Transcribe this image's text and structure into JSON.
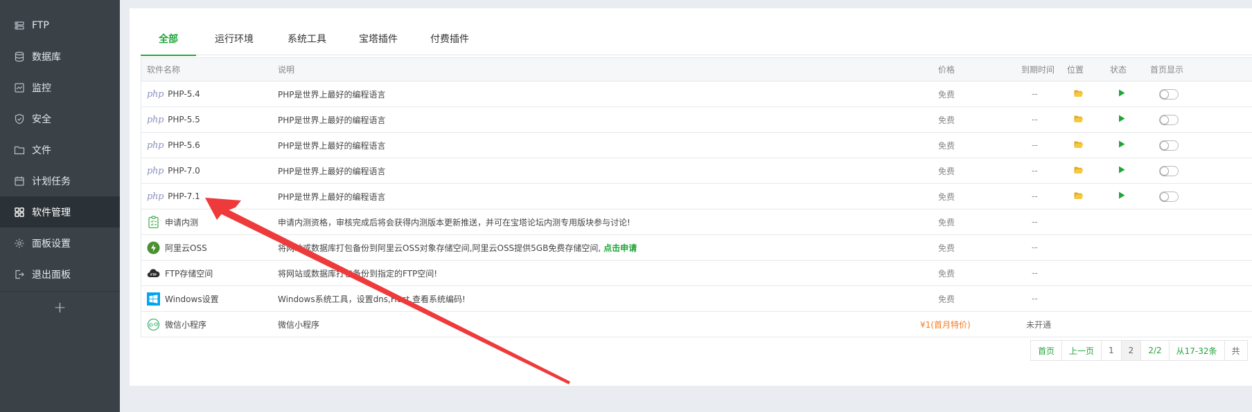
{
  "sidebar": {
    "items": [
      {
        "label": "FTP",
        "icon": "ftp-icon"
      },
      {
        "label": "数据库",
        "icon": "database-icon"
      },
      {
        "label": "监控",
        "icon": "monitor-icon"
      },
      {
        "label": "安全",
        "icon": "shield-icon"
      },
      {
        "label": "文件",
        "icon": "folder-icon"
      },
      {
        "label": "计划任务",
        "icon": "calendar-icon"
      },
      {
        "label": "软件管理",
        "icon": "grid-icon",
        "active": true
      },
      {
        "label": "面板设置",
        "icon": "gear-icon"
      },
      {
        "label": "退出面板",
        "icon": "logout-icon"
      }
    ],
    "add_label": "+"
  },
  "tabs": [
    {
      "label": "全部",
      "active": true
    },
    {
      "label": "运行环境"
    },
    {
      "label": "系统工具"
    },
    {
      "label": "宝塔插件"
    },
    {
      "label": "付费插件"
    }
  ],
  "table": {
    "headers": {
      "name": "软件名称",
      "desc": "说明",
      "price": "价格",
      "expire": "到期时间",
      "location": "位置",
      "status": "状态",
      "home": "首页显示"
    },
    "rows": [
      {
        "logo": "php",
        "logo_text": "php",
        "name": "PHP-5.4",
        "desc": "PHP是世界上最好的编程语言",
        "price": "免费",
        "expire": "--",
        "has_controls": true
      },
      {
        "logo": "php",
        "logo_text": "php",
        "name": "PHP-5.5",
        "desc": "PHP是世界上最好的编程语言",
        "price": "免费",
        "expire": "--",
        "has_controls": true
      },
      {
        "logo": "php",
        "logo_text": "php",
        "name": "PHP-5.6",
        "desc": "PHP是世界上最好的编程语言",
        "price": "免费",
        "expire": "--",
        "has_controls": true
      },
      {
        "logo": "php",
        "logo_text": "php",
        "name": "PHP-7.0",
        "desc": "PHP是世界上最好的编程语言",
        "price": "免费",
        "expire": "--",
        "has_controls": true
      },
      {
        "logo": "php",
        "logo_text": "php",
        "name": "PHP-7.1",
        "desc": "PHP是世界上最好的编程语言",
        "price": "免费",
        "expire": "--",
        "has_controls": true
      },
      {
        "logo": "beta",
        "name": "申请内测",
        "desc": "申请内测资格，审核完成后将会获得内测版本更新推送，并可在宝塔论坛内测专用版块参与讨论!",
        "price": "免费",
        "expire": "--"
      },
      {
        "logo": "aliyun",
        "name": "阿里云OSS",
        "desc": "将网站或数据库打包备份到阿里云OSS对象存储空间,阿里云OSS提供5GB免费存储空间,",
        "desc_link": "点击申请",
        "price": "免费",
        "expire": "--"
      },
      {
        "logo": "ftp",
        "logo_text": "FTP",
        "name": "FTP存储空间",
        "desc": "将网站或数据库打包备份到指定的FTP空间!",
        "price": "免费",
        "expire": "--"
      },
      {
        "logo": "windows",
        "name": "Windows设置",
        "desc": "Windows系统工具，设置dns,Host,查看系统编码!",
        "price": "免费",
        "expire": "--"
      },
      {
        "logo": "wechat",
        "name": "微信小程序",
        "desc": "微信小程序",
        "price": "¥1(首月特价)",
        "expire": "未开通",
        "paid": true
      }
    ]
  },
  "pagination": {
    "items": [
      "首页",
      "上一页",
      "1",
      "2",
      "2/2",
      "从17-32条",
      "共"
    ],
    "current": "2"
  },
  "colors": {
    "accent": "#20a53a",
    "sidebar_bg": "#3a4248",
    "sidebar_active": "#2b3237",
    "paid_price": "#f57c1f",
    "folder": "#f3c12e",
    "annotation_arrow": "#ee3a3a"
  }
}
